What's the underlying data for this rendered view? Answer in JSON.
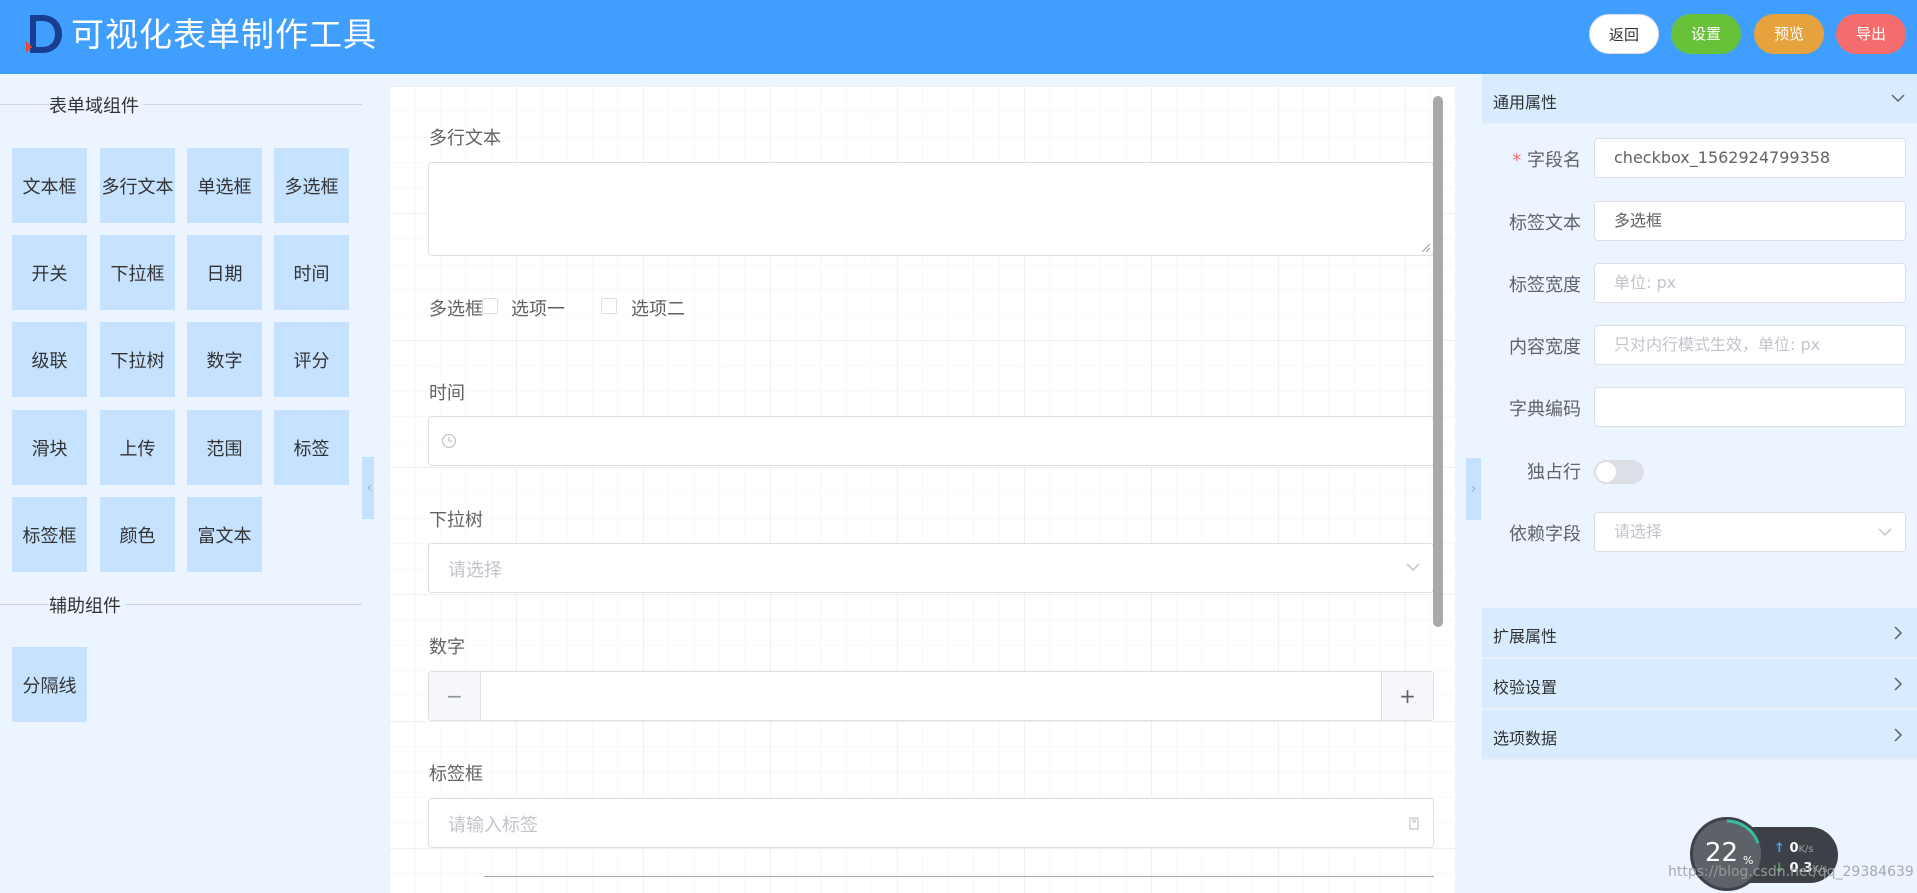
{
  "header": {
    "title": "可视化表单制作工具",
    "buttons": {
      "back": "返回",
      "settings": "设置",
      "preview": "预览",
      "export": "导出"
    },
    "colors": {
      "bar": "#409eff",
      "settings": "#67c23a",
      "preview": "#e6a23c",
      "export": "#f56c6c"
    }
  },
  "left_panel": {
    "form_section_title": "表单域组件",
    "form_components": [
      "文本框",
      "多行文本",
      "单选框",
      "多选框",
      "开关",
      "下拉框",
      "日期",
      "时间",
      "级联",
      "下拉树",
      "数字",
      "评分",
      "滑块",
      "上传",
      "范围",
      "标签",
      "标签框",
      "颜色",
      "富文本"
    ],
    "aux_section_title": "辅助组件",
    "aux_components": [
      "分隔线"
    ]
  },
  "canvas": {
    "fields": {
      "textarea": {
        "label": "多行文本"
      },
      "checkbox": {
        "label": "多选框",
        "options": [
          "选项一",
          "选项二"
        ]
      },
      "time": {
        "label": "时间"
      },
      "tree_select": {
        "label": "下拉树",
        "placeholder": "请选择"
      },
      "number": {
        "label": "数字"
      },
      "tag_box": {
        "label": "标签框",
        "placeholder": "请输入标签"
      }
    }
  },
  "right_panel": {
    "general_title": "通用属性",
    "props": {
      "field_name": {
        "label": "字段名",
        "value": "checkbox_1562924799358",
        "required": "*"
      },
      "label_text": {
        "label": "标签文本",
        "value": "多选框"
      },
      "label_width": {
        "label": "标签宽度",
        "placeholder": "单位: px"
      },
      "content_width": {
        "label": "内容宽度",
        "placeholder": "只对内行模式生效，单位: px"
      },
      "dict_code": {
        "label": "字典编码",
        "value": ""
      },
      "full_row": {
        "label": "独占行",
        "on": false
      },
      "depends_on": {
        "label": "依赖字段",
        "placeholder": "请选择"
      }
    },
    "sections": [
      "扩展属性",
      "校验设置",
      "选项数据"
    ]
  },
  "widget": {
    "percent": "22",
    "percent_unit": "%",
    "up": "0",
    "up_unit": "K/s",
    "down": "0.3",
    "down_unit": "K/s"
  },
  "watermark": "https://blog.csdn.net/qq_29384639"
}
